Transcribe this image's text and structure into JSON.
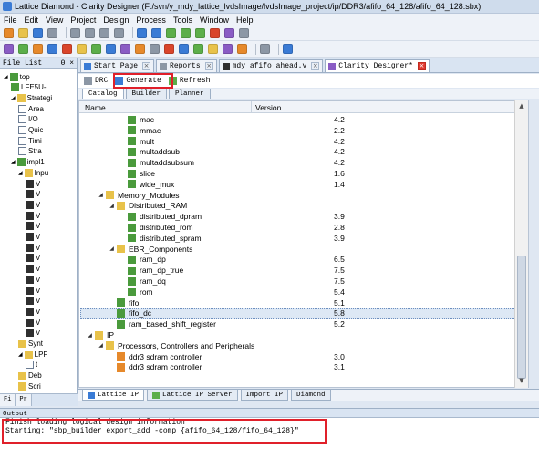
{
  "window": {
    "title": "Lattice Diamond - Clarity Designer (F:/svn/y_mdy_lattice_lvdsImage/lvdsImage_project/ip/DDR3/afifo_64_128/afifo_64_128.sbx)"
  },
  "menu": [
    "File",
    "Edit",
    "View",
    "Project",
    "Design",
    "Process",
    "Tools",
    "Window",
    "Help"
  ],
  "file_list": {
    "header": "File List",
    "pin": "Θ ×",
    "items": [
      {
        "label": "top",
        "icon": "chip-icon",
        "expander": "◢"
      },
      {
        "label": "LFE5U-",
        "icon": "chip-icon",
        "expander": ""
      },
      {
        "label": "Strategi",
        "icon": "folder-icon",
        "expander": "◢"
      },
      {
        "label": "Area",
        "icon": "file-icon",
        "expander": ""
      },
      {
        "label": "I/O",
        "icon": "file-icon",
        "expander": ""
      },
      {
        "label": "Quic",
        "icon": "file-icon",
        "expander": ""
      },
      {
        "label": "Timi",
        "icon": "file-icon",
        "expander": ""
      },
      {
        "label": "Stra",
        "icon": "file-icon",
        "expander": ""
      },
      {
        "label": "impl1",
        "icon": "chip-icon",
        "expander": "◢"
      },
      {
        "label": "Inpu",
        "icon": "folder-icon",
        "expander": "◢"
      },
      {
        "label": "V",
        "icon": "verilog-icon",
        "expander": ""
      },
      {
        "label": "V",
        "icon": "verilog-icon",
        "expander": ""
      },
      {
        "label": "V",
        "icon": "verilog-icon",
        "expander": ""
      },
      {
        "label": "V",
        "icon": "verilog-icon",
        "expander": ""
      },
      {
        "label": "V",
        "icon": "verilog-icon",
        "expander": ""
      },
      {
        "label": "V",
        "icon": "verilog-icon",
        "expander": ""
      },
      {
        "label": "V",
        "icon": "verilog-icon",
        "expander": ""
      },
      {
        "label": "V",
        "icon": "verilog-icon",
        "expander": ""
      },
      {
        "label": "V",
        "icon": "verilog-icon",
        "expander": ""
      },
      {
        "label": "V",
        "icon": "verilog-icon",
        "expander": ""
      },
      {
        "label": "V",
        "icon": "verilog-icon",
        "expander": ""
      },
      {
        "label": "V",
        "icon": "verilog-icon",
        "expander": ""
      },
      {
        "label": "V",
        "icon": "verilog-icon",
        "expander": ""
      },
      {
        "label": "V",
        "icon": "verilog-icon",
        "expander": ""
      },
      {
        "label": "V",
        "icon": "verilog-icon",
        "expander": ""
      },
      {
        "label": "Synt",
        "icon": "folder-icon",
        "expander": ""
      },
      {
        "label": "LPF",
        "icon": "folder-icon",
        "expander": "◢"
      },
      {
        "label": "t",
        "icon": "file-icon",
        "expander": ""
      },
      {
        "label": "Deb",
        "icon": "folder-icon",
        "expander": ""
      },
      {
        "label": "Scri",
        "icon": "folder-icon",
        "expander": ""
      }
    ],
    "tabs": [
      "Fi",
      "Pr"
    ]
  },
  "editor_tabs": [
    {
      "label": "Start Page",
      "active": false
    },
    {
      "label": "Reports",
      "active": false
    },
    {
      "label": "mdy_afifo_ahead.v",
      "active": false
    },
    {
      "label": "Clarity Designer*",
      "active": true
    }
  ],
  "clarity_toolbar": {
    "drc": "DRC",
    "generate": "Generate",
    "refresh": "Refresh"
  },
  "sub_tabs": [
    "Catalog",
    "Builder",
    "Planner"
  ],
  "catalog": {
    "col_name": "Name",
    "col_version": "Version",
    "rows": [
      {
        "name": "mac",
        "version": "4.2",
        "indent": 3,
        "kind": "module",
        "expander": ""
      },
      {
        "name": "mmac",
        "version": "2.2",
        "indent": 3,
        "kind": "module",
        "expander": ""
      },
      {
        "name": "mult",
        "version": "4.2",
        "indent": 3,
        "kind": "module",
        "expander": ""
      },
      {
        "name": "multaddsub",
        "version": "4.2",
        "indent": 3,
        "kind": "module",
        "expander": ""
      },
      {
        "name": "multaddsubsum",
        "version": "4.2",
        "indent": 3,
        "kind": "module",
        "expander": ""
      },
      {
        "name": "slice",
        "version": "1.6",
        "indent": 3,
        "kind": "module",
        "expander": ""
      },
      {
        "name": "wide_mux",
        "version": "1.4",
        "indent": 3,
        "kind": "module",
        "expander": ""
      },
      {
        "name": "Memory_Modules",
        "version": "",
        "indent": 1,
        "kind": "folder",
        "expander": "◢"
      },
      {
        "name": "Distributed_RAM",
        "version": "",
        "indent": 2,
        "kind": "folder",
        "expander": "◢"
      },
      {
        "name": "distributed_dpram",
        "version": "3.9",
        "indent": 3,
        "kind": "module",
        "expander": ""
      },
      {
        "name": "distributed_rom",
        "version": "2.8",
        "indent": 3,
        "kind": "module",
        "expander": ""
      },
      {
        "name": "distributed_spram",
        "version": "3.9",
        "indent": 3,
        "kind": "module",
        "expander": ""
      },
      {
        "name": "EBR_Components",
        "version": "",
        "indent": 2,
        "kind": "folder",
        "expander": "◢"
      },
      {
        "name": "ram_dp",
        "version": "6.5",
        "indent": 3,
        "kind": "module",
        "expander": ""
      },
      {
        "name": "ram_dp_true",
        "version": "7.5",
        "indent": 3,
        "kind": "module",
        "expander": ""
      },
      {
        "name": "ram_dq",
        "version": "7.5",
        "indent": 3,
        "kind": "module",
        "expander": ""
      },
      {
        "name": "rom",
        "version": "5.4",
        "indent": 3,
        "kind": "module",
        "expander": ""
      },
      {
        "name": "fifo",
        "version": "5.1",
        "indent": 2,
        "kind": "module",
        "expander": ""
      },
      {
        "name": "fifo_dc",
        "version": "5.8",
        "indent": 2,
        "kind": "module",
        "expander": "",
        "selected": true
      },
      {
        "name": "ram_based_shift_register",
        "version": "5.2",
        "indent": 2,
        "kind": "module",
        "expander": ""
      },
      {
        "name": "IP",
        "version": "",
        "indent": 0,
        "kind": "folder",
        "expander": "◢"
      },
      {
        "name": "Processors, Controllers and Peripherals",
        "version": "",
        "indent": 1,
        "kind": "folder",
        "expander": "◢"
      },
      {
        "name": "ddr3 sdram controller",
        "version": "3.0",
        "indent": 2,
        "kind": "ip",
        "expander": ""
      },
      {
        "name": "ddr3 sdram controller",
        "version": "3.1",
        "indent": 2,
        "kind": "ip",
        "expander": ""
      }
    ]
  },
  "bottom_tabs": [
    {
      "label": "Lattice IP",
      "active": true
    },
    {
      "label": "Lattice IP Server",
      "active": false
    },
    {
      "label": "Import IP",
      "active": false
    },
    {
      "label": "Diamond",
      "active": false
    }
  ],
  "output": {
    "header": "Output",
    "lines": [
      "Finish loading logical design information",
      "Starting: \"sbp_builder export_add -comp {afifo_64_128/fifo_64_128}\""
    ]
  },
  "colors": {
    "highlight": "#e0202a",
    "selection": "#dde8f5",
    "module_icon": "#4a9a3c",
    "folder_icon": "#e8c24a"
  }
}
